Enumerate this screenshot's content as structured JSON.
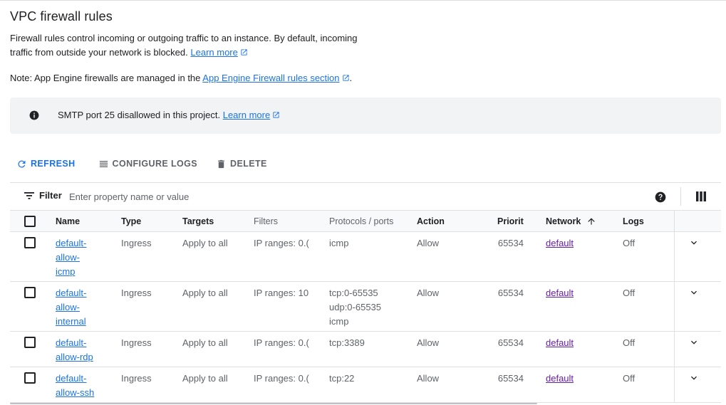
{
  "page": {
    "title": "VPC firewall rules",
    "desc_text": "Firewall rules control incoming or outgoing traffic to an instance. By default, incoming traffic from outside your network is blocked.",
    "desc_link": "Learn more",
    "note_text": "Note: App Engine firewalls are managed in the",
    "note_link": "App Engine Firewall rules section",
    "note_end": "."
  },
  "banner": {
    "text": "SMTP port 25 disallowed in this project.",
    "link": "Learn more"
  },
  "toolbar": {
    "refresh": "REFRESH",
    "configure_logs": "CONFIGURE LOGS",
    "delete": "DELETE"
  },
  "filter": {
    "label": "Filter",
    "placeholder": "Enter property name or value"
  },
  "table": {
    "headers": {
      "name": "Name",
      "type": "Type",
      "targets": "Targets",
      "filters": "Filters",
      "protocols": "Protocols / ports",
      "action": "Action",
      "priority": "Priority",
      "network": "Network",
      "logs": "Logs"
    },
    "rows": [
      {
        "name1": "default-",
        "name2": "allow-",
        "name3": "icmp",
        "type": "Ingress",
        "targets": "Apply to all",
        "filters": "IP ranges: 0.(",
        "proto1": "icmp",
        "proto2": "",
        "proto3": "",
        "action": "Allow",
        "priority": "65534",
        "network": "default",
        "logs": "Off"
      },
      {
        "name1": "default-",
        "name2": "allow-",
        "name3": "internal",
        "type": "Ingress",
        "targets": "Apply to all",
        "filters": "IP ranges: 10",
        "proto1": "tcp:0-65535",
        "proto2": "udp:0-65535",
        "proto3": "icmp",
        "action": "Allow",
        "priority": "65534",
        "network": "default",
        "logs": "Off"
      },
      {
        "name1": "default-",
        "name2": "allow-rdp",
        "name3": "",
        "type": "Ingress",
        "targets": "Apply to all",
        "filters": "IP ranges: 0.(",
        "proto1": "tcp:3389",
        "proto2": "",
        "proto3": "",
        "action": "Allow",
        "priority": "65534",
        "network": "default",
        "logs": "Off"
      },
      {
        "name1": "default-",
        "name2": "allow-ssh",
        "name3": "",
        "type": "Ingress",
        "targets": "Apply to all",
        "filters": "IP ranges: 0.(",
        "proto1": "tcp:22",
        "proto2": "",
        "proto3": "",
        "action": "Allow",
        "priority": "65534",
        "network": "default",
        "logs": "Off"
      }
    ]
  },
  "colors": {
    "link": "#1a73e8",
    "visited_link": "#681da8",
    "banner_bg": "#f1f3f4"
  },
  "icons": [
    "open-in-new-icon",
    "info-icon",
    "refresh-icon",
    "list-icon",
    "trash-icon",
    "filter-icon",
    "help-icon",
    "columns-icon",
    "sort-arrow-up-icon",
    "chevron-down-icon"
  ]
}
